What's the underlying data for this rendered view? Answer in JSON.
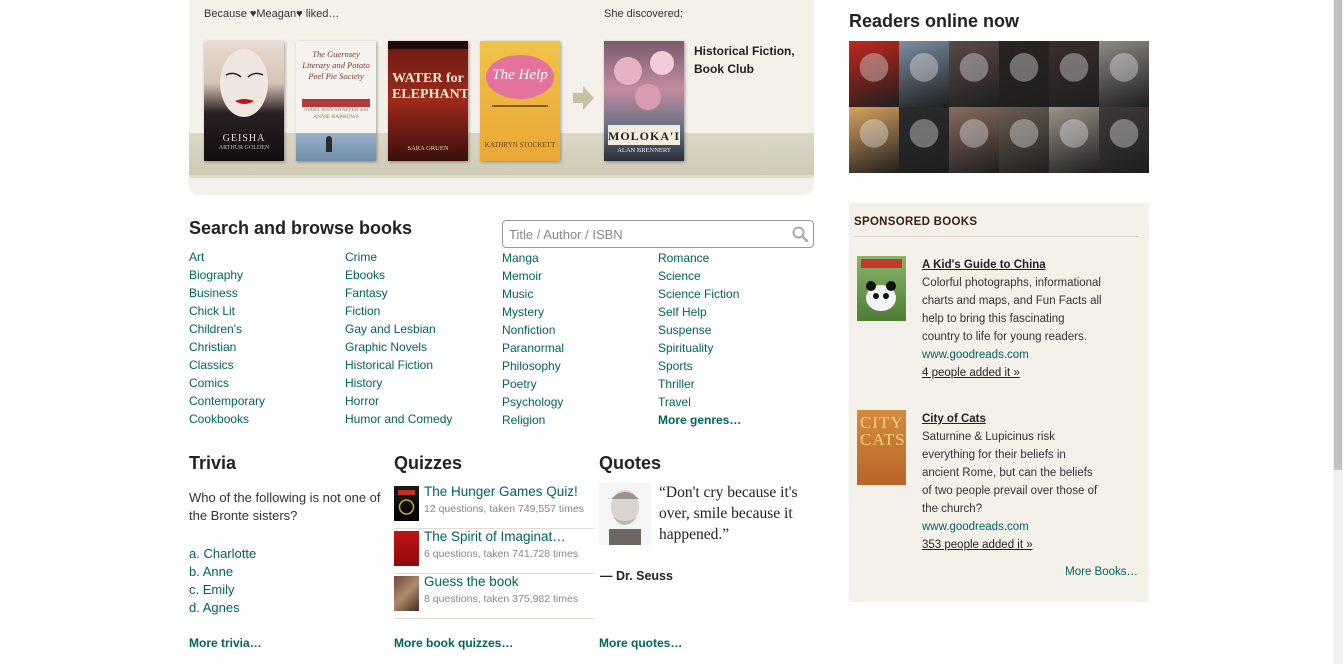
{
  "recommendation": {
    "because_label": "Because ♥Meagan♥ liked…",
    "discovered_label": "She discovered:",
    "liked_books": [
      {
        "title": "Memoirs of a Geisha",
        "cover_text": "GEISHA",
        "author_text": "ARTHUR GOLDEN"
      },
      {
        "title": "The Guernsey Literary and Potato Peel Pie Society",
        "cover_text": "The Guernsey Literary and Potato Peel Pie Society",
        "author_text": "MARY ANN SHAFFER and ANNIE BARROWS"
      },
      {
        "title": "Water for Elephants",
        "cover_text": "WATER for ELEPHANTS",
        "author_text": "SARA GRUEN"
      },
      {
        "title": "The Help",
        "cover_text": "The Help",
        "author_text": "KATHRYN STOCKETT"
      }
    ],
    "discovered_book": {
      "title": "Moloka'i",
      "cover_text": "MOLOKA'I",
      "author_text": "ALAN BRENNERT"
    },
    "discovered_genres": [
      "Historical Fiction,",
      "Book Club"
    ]
  },
  "browse": {
    "title": "Search and browse books",
    "search_placeholder": "Title / Author / ISBN",
    "columns": [
      [
        "Art",
        "Biography",
        "Business",
        "Chick Lit",
        "Children's",
        "Christian",
        "Classics",
        "Comics",
        "Contemporary",
        "Cookbooks"
      ],
      [
        "Crime",
        "Ebooks",
        "Fantasy",
        "Fiction",
        "Gay and Lesbian",
        "Graphic Novels",
        "Historical Fiction",
        "History",
        "Horror",
        "Humor and Comedy"
      ],
      [
        "Manga",
        "Memoir",
        "Music",
        "Mystery",
        "Nonfiction",
        "Paranormal",
        "Philosophy",
        "Poetry",
        "Psychology",
        "Religion"
      ],
      [
        "Romance",
        "Science",
        "Science Fiction",
        "Self Help",
        "Suspense",
        "Spirituality",
        "Sports",
        "Thriller",
        "Travel"
      ]
    ],
    "more_genres": "More genres…"
  },
  "trivia": {
    "title": "Trivia",
    "question": "Who of the following is not one of the Bronte sisters?",
    "answers": [
      "a. Charlotte",
      "b. Anne",
      "c. Emily",
      "d. Agnes"
    ],
    "more": "More trivia…"
  },
  "quizzes": {
    "title": "Quizzes",
    "items": [
      {
        "name": "The Hunger Games Quiz!",
        "meta": "12 questions, taken 749,557 times"
      },
      {
        "name": "The Spirit of Imaginat…",
        "meta": "6 questions, taken 741,728 times"
      },
      {
        "name": "Guess the book",
        "meta": "8 questions, taken 375,982 times"
      }
    ],
    "more": "More book quizzes…"
  },
  "quotes": {
    "title": "Quotes",
    "text": "“Don't cry because it's over, smile because it happened.”",
    "author": "― Dr. Seuss",
    "more": "More quotes…"
  },
  "readers": {
    "title": "Readers online now",
    "avatar_colors": [
      "#c0281e",
      "#7d8ea6",
      "#5a4a48",
      "#2a2420",
      "#3a2e2c",
      "#8f8a85",
      "#d9a35e",
      "#2b2b2e",
      "#8a6c5e",
      "#6b5e52",
      "#9a928a",
      "#403a3a"
    ]
  },
  "sponsored": {
    "title": "SPONSORED BOOKS",
    "items": [
      {
        "title": "A Kid's Guide to China",
        "description": "Colorful photographs, informational charts and maps, and Fun Facts all help to bring this fascinating country to life for young readers.",
        "url": "www.goodreads.com",
        "added": "4 people added it »"
      },
      {
        "title": "City of Cats",
        "description": "Saturnine & Lupicinus risk everything for their beliefs in ancient Rome, but can the beliefs of two people prevail over those of the church?",
        "url": "www.goodreads.com",
        "added": "353 people added it »"
      }
    ],
    "more": "More Books…"
  },
  "colors": {
    "brand_green": "#00635d",
    "panel_beige": "#f4f1ea"
  }
}
